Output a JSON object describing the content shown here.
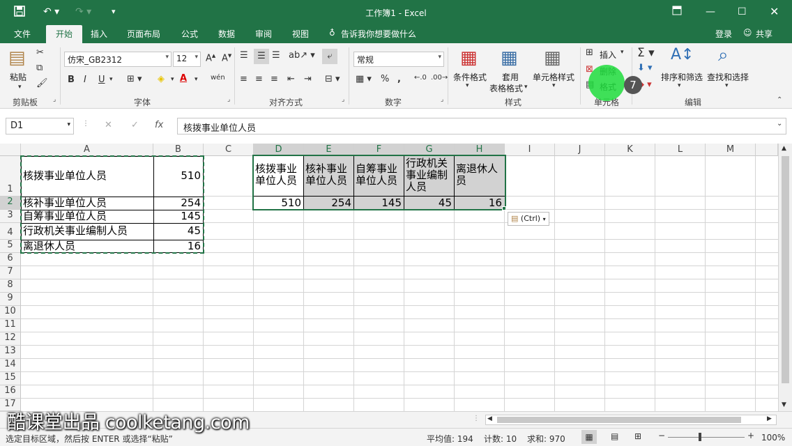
{
  "window": {
    "title": "工作簿1 - Excel"
  },
  "tabs": [
    {
      "label": "文件"
    },
    {
      "label": "开始"
    },
    {
      "label": "插入"
    },
    {
      "label": "页面布局"
    },
    {
      "label": "公式"
    },
    {
      "label": "数据"
    },
    {
      "label": "审阅"
    },
    {
      "label": "视图"
    }
  ],
  "tell_me": "告诉我你想要做什么",
  "account": {
    "login": "登录",
    "share": "共享"
  },
  "ribbon": {
    "clipboard": {
      "paste": "粘贴",
      "label": "剪贴板"
    },
    "font": {
      "name": "仿宋_GB2312",
      "size": "12",
      "label": "字体",
      "bold": "B",
      "italic": "I",
      "underline": "U"
    },
    "alignment": {
      "label": "对齐方式"
    },
    "number": {
      "format": "常规",
      "label": "数字",
      "percent": "%",
      "comma": ","
    },
    "styles": {
      "conditional": "条件格式",
      "table_line1": "套用",
      "table_line2": "表格格式",
      "cell_styles": "单元格样式",
      "label": "样式"
    },
    "cells": {
      "insert": "插入",
      "delete": "删除",
      "format": "格式",
      "label": "单元格"
    },
    "editing": {
      "sort_filter": "排序和筛选",
      "find_select": "查找和选择",
      "label": "编辑"
    }
  },
  "formula_bar": {
    "name_box": "D1",
    "fx": "fx",
    "content": "核拨事业单位人员"
  },
  "columns": [
    "A",
    "B",
    "C",
    "D",
    "E",
    "F",
    "G",
    "H",
    "I",
    "J",
    "K",
    "L",
    "M"
  ],
  "rows": [
    "1",
    "2",
    "3",
    "4",
    "5",
    "6",
    "7",
    "8",
    "9",
    "10",
    "11",
    "12",
    "13",
    "14",
    "15",
    "16",
    "17"
  ],
  "source_table": [
    {
      "label": "核拨事业单位人员",
      "value": "510"
    },
    {
      "label": "核补事业单位人员",
      "value": "254"
    },
    {
      "label": "自筹事业单位人员",
      "value": "145"
    },
    {
      "label": "行政机关事业编制人员",
      "value": "45"
    },
    {
      "label": "离退休人员",
      "value": "16"
    }
  ],
  "transposed": {
    "headers": [
      [
        "核拨事业",
        "单位人员"
      ],
      [
        "核补事业",
        "单位人员"
      ],
      [
        "自筹事业",
        "单位人员"
      ],
      [
        "行政机关",
        "事业编制",
        "人员"
      ],
      [
        "离退休人",
        "员"
      ]
    ],
    "values": [
      "510",
      "254",
      "145",
      "45",
      "16"
    ]
  },
  "paste_options": "(Ctrl)",
  "step_badge": "7",
  "watermark": "酷课堂出品 coolketang.com",
  "status": {
    "message": "选定目标区域，然后按 ENTER 或选择“粘贴”",
    "average": "平均值: 194",
    "count": "计数: 10",
    "sum": "求和: 970",
    "zoom": "100%"
  },
  "colors": {
    "accent": "#217346",
    "selection_fill": "#d2d2d2"
  }
}
